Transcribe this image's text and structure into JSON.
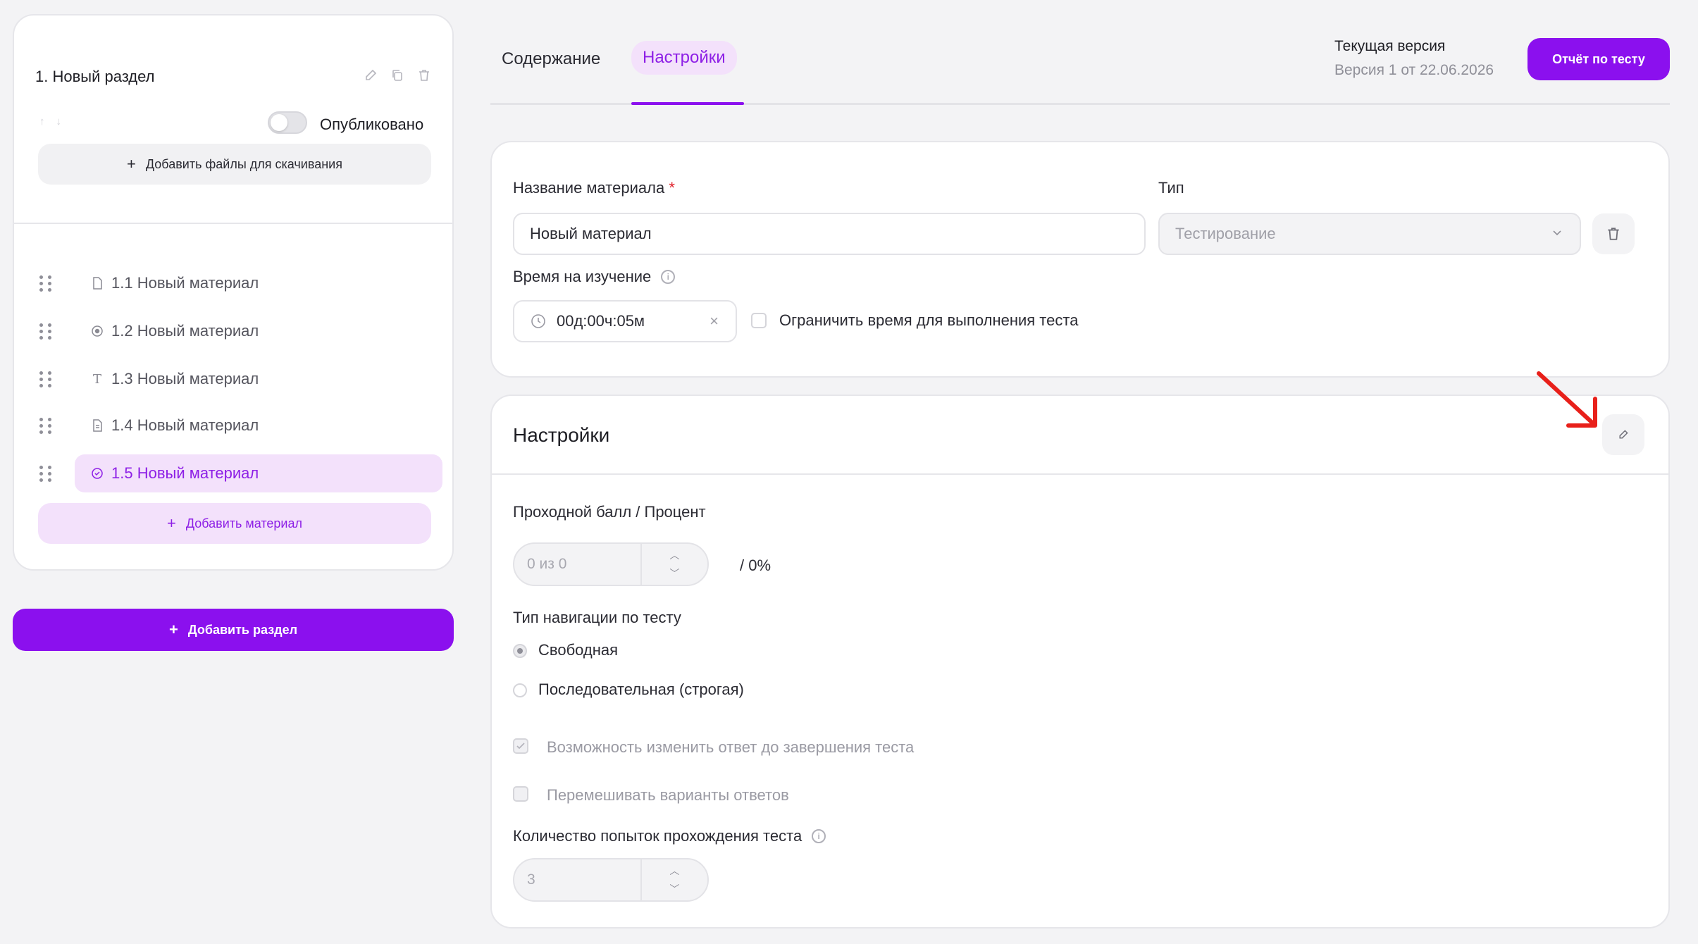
{
  "sidebar": {
    "section_title": "1. Новый раздел",
    "published_label": "Опубликовано",
    "add_files_label": "Добавить файлы для скачивания",
    "items": [
      {
        "label": "1.1 Новый материал",
        "icon": "file-icon"
      },
      {
        "label": "1.2 Новый материал",
        "icon": "video-icon"
      },
      {
        "label": "1.3 Новый материал",
        "icon": "text-icon"
      },
      {
        "label": "1.4 Новый материал",
        "icon": "document-icon"
      },
      {
        "label": "1.5 Новый материал",
        "icon": "test-check-icon"
      }
    ],
    "add_material_label": "Добавить материал",
    "add_section_label": "Добавить раздел"
  },
  "header": {
    "tabs": [
      "Содержание",
      "Настройки"
    ],
    "active_tab": "Настройки",
    "version_label": "Текущая версия",
    "version_value": "Версия 1 от 22.06.2026",
    "report_button": "Отчёт по тесту"
  },
  "material": {
    "name_label": "Название материала",
    "required_mark": "*",
    "name_value": "Новый материал",
    "type_label": "Тип",
    "type_value": "Тестирование",
    "time_label": "Время на изучение",
    "time_value": "00д:00ч:05м",
    "limit_time_label": "Ограничить время для выполнения теста"
  },
  "settings": {
    "title": "Настройки",
    "pass_score_label": "Проходной балл / Процент",
    "pass_score_value": "0 из 0",
    "pass_percent": "/ 0%",
    "nav_type_label": "Тип навигации по тесту",
    "nav_options": [
      "Свободная",
      "Последовательная (строгая)"
    ],
    "nav_selected": "Свободная",
    "change_answer_label": "Возможность изменить ответ до завершения теста",
    "shuffle_label": "Перемешивать варианты ответов",
    "attempts_label": "Количество попыток прохождения теста",
    "attempts_value": "3"
  },
  "colors": {
    "accent": "#8b10ee",
    "accent_light": "#f3e1fb",
    "annotation_arrow": "#e8201a"
  }
}
